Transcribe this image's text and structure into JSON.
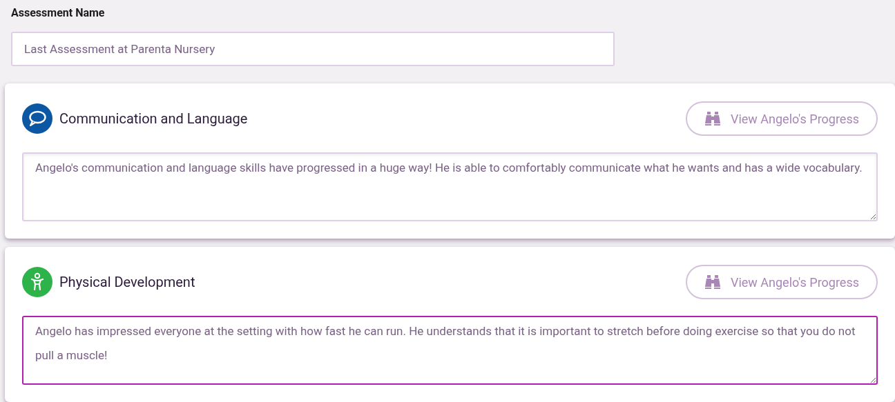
{
  "assessment_name": {
    "label": "Assessment Name",
    "value": "Last Assessment at Parenta Nursery"
  },
  "areas": [
    {
      "kind": "speech",
      "title": "Communication and Language",
      "button": "View Angelo's Progress",
      "notes": "Angelo's communication and language skills have progressed in a huge way! He is able to comfortably communicate what he wants and has a wide vocabulary.",
      "focused": false
    },
    {
      "kind": "physical",
      "title": "Physical Development",
      "button": "View Angelo's Progress",
      "notes": "Angelo has impressed everyone at the setting with how fast he can run. He understands that it is important to stretch before doing exercise so that you do not pull a muscle!",
      "focused": true
    }
  ]
}
